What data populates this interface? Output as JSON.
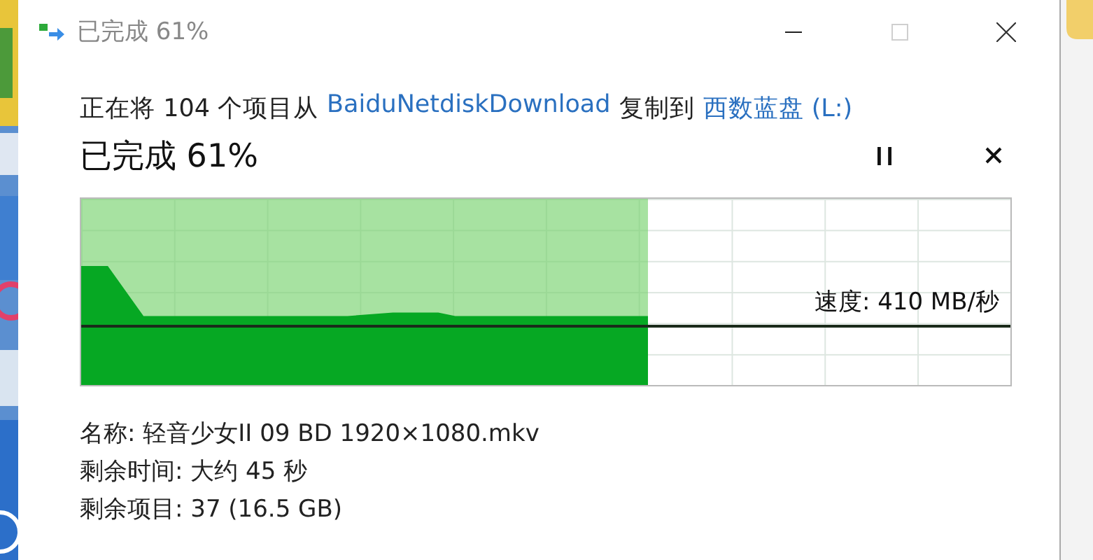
{
  "window": {
    "title": "已完成 61%",
    "maximize_disabled": true
  },
  "copy": {
    "prefix": "正在将 104 个项目从",
    "source": "BaiduNetdiskDownload",
    "middle": "复制到",
    "destination": "西数蓝盘 (L:)"
  },
  "progress": {
    "status": "已完成 61%",
    "level": 0.61
  },
  "speed": "速度: 410 MB/秒",
  "details": [
    "名称: 轻音少女II 09 BD 1920×1080.mkv",
    "剩余时间: 大约 45 秒",
    "剩余项目: 37 (16.5 GB)"
  ]
}
